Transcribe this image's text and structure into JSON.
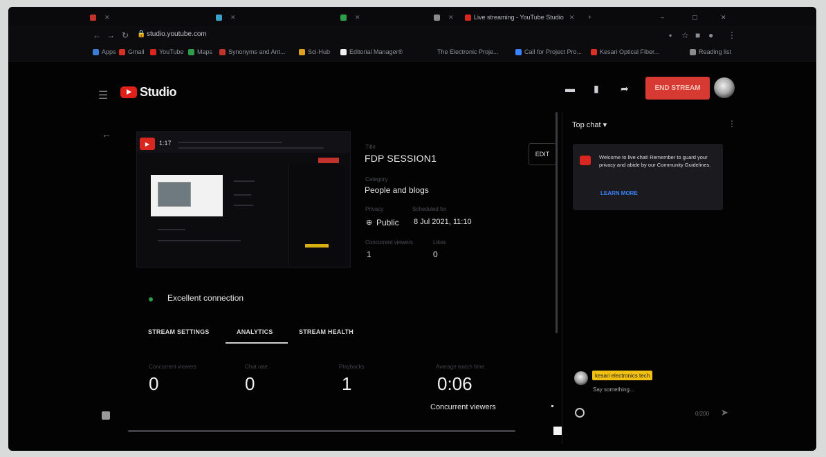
{
  "browser": {
    "tabs": [
      {
        "label": "",
        "color": "#c0332b"
      },
      {
        "label": "",
        "color": "#3aa0c8"
      },
      {
        "label": "",
        "color": "#2e9e4a"
      },
      {
        "label": "",
        "color": "#8a8a8a"
      },
      {
        "label": "Live streaming - YouTube Studio",
        "color": "#d9261f"
      }
    ],
    "url_domain": "studio.youtube.com",
    "bookmarks": [
      {
        "label": "Apps",
        "color": "#3a7bd5"
      },
      {
        "label": "Gmail",
        "color": "#d93025"
      },
      {
        "label": "YouTube",
        "color": "#d9261f"
      },
      {
        "label": "Maps",
        "color": "#2e9e4a"
      },
      {
        "label": "Synonyms and Ant...",
        "color": "#c0332b"
      },
      {
        "label": "Sci-Hub",
        "color": "#e0a020"
      },
      {
        "label": "Editorial Manager®",
        "color": "#f0f0f0"
      },
      {
        "label": "The Electronic Proje...",
        "color": "#9a9a9a"
      },
      {
        "label": "Call for Project Pro...",
        "color": "#3a83ff"
      },
      {
        "label": "Kesari Optical Fiber...",
        "color": "#d93025"
      },
      {
        "label": "Reading list",
        "color": "#8a8a8a"
      }
    ]
  },
  "header": {
    "logo_text": "Studio",
    "end_stream_label": "END STREAM"
  },
  "preview": {
    "clock": "1:17"
  },
  "stream": {
    "title_label": "Title",
    "title": "FDP SESSION1",
    "category_label": "Category",
    "category": "People and blogs",
    "privacy_label": "Privacy",
    "privacy": "Public",
    "scheduled_label": "Scheduled for",
    "scheduled": "8 Jul 2021, 11:10",
    "concurrent_label": "Concurrent viewers",
    "concurrent": "1",
    "likes_label": "Likes",
    "likes": "0",
    "edit_label": "EDIT"
  },
  "connection": {
    "status": "Excellent connection",
    "status_color": "#2e9e4a"
  },
  "tabs": [
    "STREAM SETTINGS",
    "ANALYTICS",
    "STREAM HEALTH"
  ],
  "active_tab": "ANALYTICS",
  "stats": [
    {
      "label": "Concurrent viewers",
      "value": "0"
    },
    {
      "label": "Chat rate",
      "value": "0"
    },
    {
      "label": "Playbacks",
      "value": "1"
    },
    {
      "label": "Average watch time",
      "value": "0:06"
    }
  ],
  "chart": {
    "title": "Concurrent viewers"
  },
  "chat": {
    "mode": "Top chat",
    "welcome": "Welcome to live chat! Remember to guard your privacy and abide by our Community Guidelines.",
    "learn_more": "LEARN MORE",
    "user": "kesari electronics tech",
    "input_placeholder": "Say something...",
    "char_count": "0/200"
  },
  "colors": {
    "accent_red": "#d63a33",
    "link_blue": "#3a83ff",
    "user_badge": "#f2c013"
  }
}
